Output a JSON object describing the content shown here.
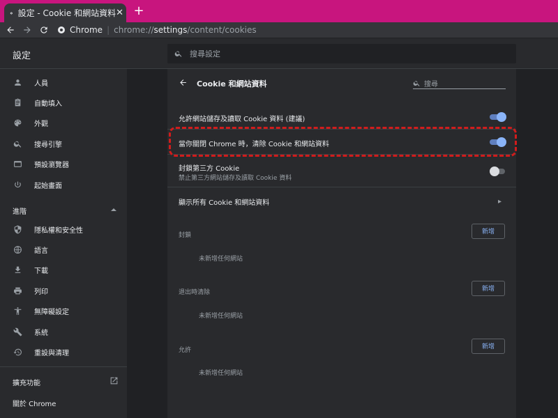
{
  "tab": {
    "title": "設定 - Cookie 和網站資料",
    "close": "✕"
  },
  "newtab": "+",
  "omnibox": {
    "site_label": "Chrome",
    "url_prefix": "chrome://",
    "url_path": "settings",
    "url_rest": "/content/cookies"
  },
  "header": {
    "title": "設定",
    "search_placeholder": "搜尋設定"
  },
  "sidebar": {
    "items": [
      {
        "label": "人員",
        "icon": "person-icon"
      },
      {
        "label": "自動填入",
        "icon": "clipboard-icon"
      },
      {
        "label": "外觀",
        "icon": "palette-icon"
      },
      {
        "label": "搜尋引擎",
        "icon": "search-icon"
      },
      {
        "label": "預設瀏覽器",
        "icon": "browser-icon"
      },
      {
        "label": "起始畫面",
        "icon": "power-icon"
      }
    ],
    "advanced": "進階",
    "advanced_items": [
      {
        "label": "隱私權和安全性",
        "icon": "shield-icon"
      },
      {
        "label": "語言",
        "icon": "globe-icon"
      },
      {
        "label": "下載",
        "icon": "download-icon"
      },
      {
        "label": "列印",
        "icon": "printer-icon"
      },
      {
        "label": "無障礙設定",
        "icon": "accessibility-icon"
      },
      {
        "label": "系統",
        "icon": "wrench-icon"
      },
      {
        "label": "重設與清理",
        "icon": "restore-icon"
      }
    ],
    "extensions": "擴充功能",
    "about": "關於 Chrome"
  },
  "content": {
    "title": "Cookie 和網站資料",
    "search_placeholder": "搜尋",
    "allow_cookies": {
      "label": "允許網站儲存及讀取 Cookie 資料 (建議)",
      "enabled": true
    },
    "clear_on_exit": {
      "label": "當你關閉 Chrome 時，清除 Cookie 和網站資料",
      "enabled": true
    },
    "block_third_party": {
      "label": "封鎖第三方 Cookie",
      "sublabel": "禁止第三方網站儲存及讀取 Cookie 資料",
      "enabled": false
    },
    "see_all": "顯示所有 Cookie 和網站資料",
    "sections": [
      {
        "label": "封鎖",
        "add": "新增",
        "empty": "未新增任何網站"
      },
      {
        "label": "退出時清除",
        "add": "新增",
        "empty": "未新增任何網站"
      },
      {
        "label": "允許",
        "add": "新增",
        "empty": "未新增任何網站"
      }
    ]
  },
  "colors": {
    "titlebar": "#c8157e",
    "accent": "#8ab4f8",
    "highlight": "#d11c1c"
  }
}
